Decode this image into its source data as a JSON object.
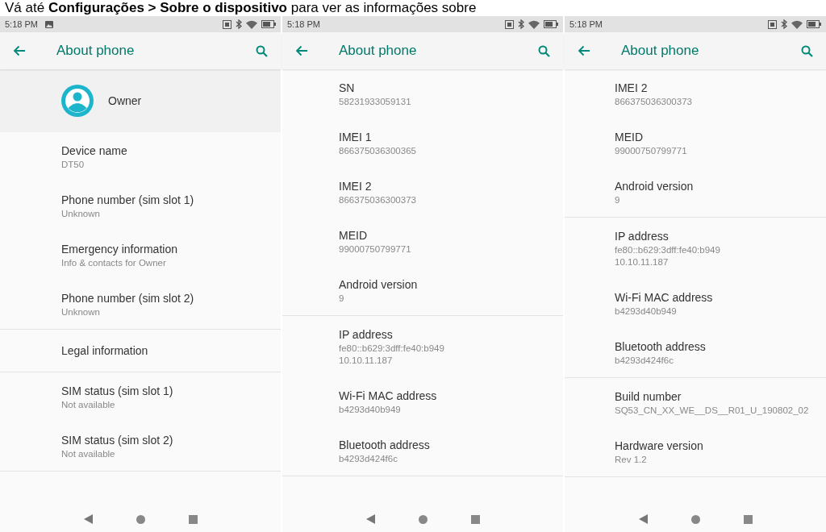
{
  "caption": "Vá até **Configurações > Sobre o dispositivo** para ver as informações sobre",
  "phones": [
    {
      "status_time": "5:18 PM",
      "notification_icon": true,
      "title": "About phone",
      "profile": {
        "name": "Owner"
      },
      "sections": [
        [
          {
            "title": "Device name",
            "lines": [
              "DT50"
            ]
          },
          {
            "title": "Phone number (sim slot 1)",
            "lines": [
              "Unknown"
            ]
          },
          {
            "title": "Emergency information",
            "lines": [
              "Info & contacts for Owner"
            ]
          },
          {
            "title": "Phone number (sim slot 2)",
            "lines": [
              "Unknown"
            ]
          }
        ],
        [
          {
            "title": "Legal information"
          }
        ],
        [
          {
            "title": "SIM status (sim slot 1)",
            "lines": [
              "Not available"
            ]
          },
          {
            "title": "SIM status (sim slot 2)",
            "lines": [
              "Not available"
            ]
          }
        ]
      ]
    },
    {
      "status_time": "5:18 PM",
      "notification_icon": false,
      "title": "About phone",
      "sections": [
        [
          {
            "title": "SN",
            "lines": [
              "58231933059131"
            ]
          },
          {
            "title": "IMEI 1",
            "lines": [
              "866375036300365"
            ]
          },
          {
            "title": "IMEI 2",
            "lines": [
              "866375036300373"
            ]
          },
          {
            "title": "MEID",
            "lines": [
              "99000750799771"
            ]
          },
          {
            "title": "Android version",
            "lines": [
              "9"
            ]
          }
        ],
        [
          {
            "title": "IP address",
            "lines": [
              "fe80::b629:3dff:fe40:b949",
              "10.10.11.187"
            ]
          },
          {
            "title": "Wi-Fi MAC address",
            "lines": [
              "b4293d40b949"
            ]
          },
          {
            "title": "Bluetooth address",
            "lines": [
              "b4293d424f6c"
            ]
          }
        ]
      ]
    },
    {
      "status_time": "5:18 PM",
      "notification_icon": false,
      "title": "About phone",
      "sections": [
        [
          {
            "title": "IMEI 2",
            "lines": [
              "866375036300373"
            ]
          },
          {
            "title": "MEID",
            "lines": [
              "99000750799771"
            ]
          },
          {
            "title": "Android version",
            "lines": [
              "9"
            ]
          }
        ],
        [
          {
            "title": "IP address",
            "lines": [
              "fe80::b629:3dff:fe40:b949",
              "10.10.11.187"
            ]
          },
          {
            "title": "Wi-Fi MAC address",
            "lines": [
              "b4293d40b949"
            ]
          },
          {
            "title": "Bluetooth address",
            "lines": [
              "b4293d424f6c"
            ]
          }
        ],
        [
          {
            "title": "Build number",
            "lines": [
              "SQ53_CN_XX_WE__DS__R01_U_190802_02"
            ]
          },
          {
            "title": "Hardware version",
            "lines": [
              "Rev 1.2"
            ]
          }
        ]
      ]
    }
  ]
}
